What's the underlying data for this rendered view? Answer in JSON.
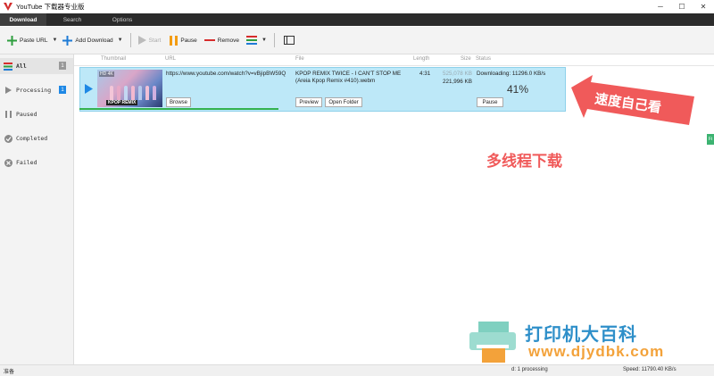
{
  "window": {
    "title": "YouTube 下载器专业版",
    "controls": [
      "─",
      "☐",
      "✕"
    ]
  },
  "tabs": [
    {
      "label": "Download",
      "active": true
    },
    {
      "label": "Search",
      "active": false
    },
    {
      "label": "Options",
      "active": false
    }
  ],
  "toolbar": {
    "paste_url": "Paste URL",
    "add_download": "Add Download",
    "start": "Start",
    "pause": "Pause",
    "remove": "Remove"
  },
  "sidebar": {
    "items": [
      {
        "label": "All",
        "count": "1"
      },
      {
        "label": "Processing",
        "count": "1"
      },
      {
        "label": "Paused"
      },
      {
        "label": "Completed"
      },
      {
        "label": "Failed"
      }
    ]
  },
  "columns": {
    "thumbnail": "Thumbnail",
    "url": "URL",
    "file": "File",
    "length": "Length",
    "size": "Size",
    "status": "Status"
  },
  "download": {
    "thumb_tag": "HD 4K",
    "thumb_banner": "KPOP REMIX",
    "url": "https://www.youtube.com/watch?v=vBjipBW59Q",
    "file_line1": "KPOP REMIX   TWICE - I CAN'T STOP ME",
    "file_line2": "(Areia Kpop Remix #410).webm",
    "length": "4:31",
    "size_done": "525,078 KB",
    "size_total": "221,996 KB",
    "status": "Downloading: 11296.0 KB/s",
    "percent": "41%",
    "progress": 0.41,
    "browse": "Browse",
    "preview": "Preview",
    "open_folder": "Open Folder",
    "pause": "Pause"
  },
  "annotations": {
    "speed": "速度自己看",
    "multithread": "多线程下载"
  },
  "side_stub": "Fi",
  "statusbar": {
    "left": "准备",
    "middle": "d: 1 processing",
    "right": "Speed: 11790.40 KB/s"
  },
  "watermark": {
    "line1": "打印机大百科",
    "line2": "www.djydbk.com"
  },
  "colors": {
    "accent_blue": "#1e88e5",
    "row_bg": "#bde8f8",
    "progress": "#34b24f",
    "annotation": "#f05a5a"
  }
}
